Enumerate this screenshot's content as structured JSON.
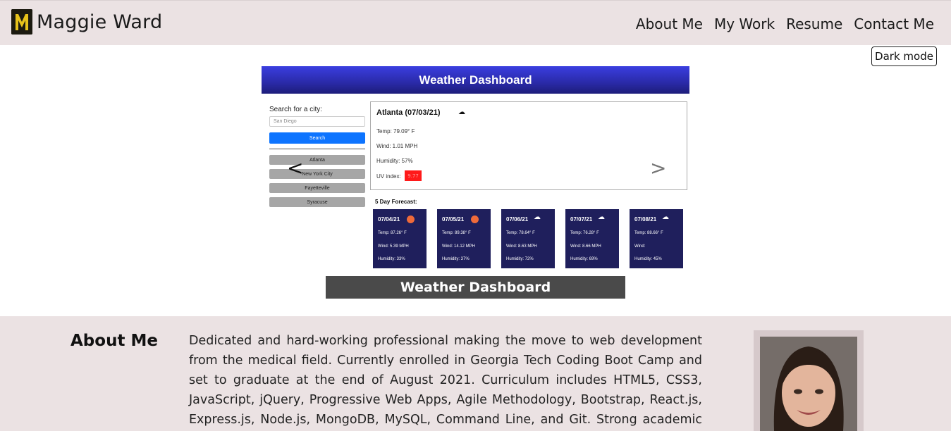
{
  "brand": {
    "name": "Maggie Ward",
    "logo_icon": "mw-monogram-logo",
    "logo_letter": "M"
  },
  "nav": {
    "items": [
      {
        "label": "About Me"
      },
      {
        "label": "My Work"
      },
      {
        "label": "Resume"
      },
      {
        "label": "Contact Me"
      }
    ]
  },
  "dark_mode_label": "Dark mode",
  "carousel": {
    "prev_label": "<",
    "next_label": ">",
    "caption": "Weather Dashboard",
    "slide": {
      "header": "Weather Dashboard",
      "search_label": "Search for a city:",
      "search_value": "San Diego",
      "search_button": "Search",
      "cities": [
        "Atlanta",
        "New York City",
        "Fayetteville",
        "Syracuse"
      ],
      "current": {
        "title": "Atlanta (07/03/21)",
        "temp": "Temp: 79.09° F",
        "wind": "Wind: 1.01 MPH",
        "humidity": "Humidity: 57%",
        "uv_label": "UV index:",
        "uv_value": "9.77"
      },
      "forecast_label": "5 Day Forecast:",
      "forecast": [
        {
          "date": "07/04/21",
          "icon": "sun-icon",
          "temp": "Temp: 87.26° F",
          "wind": "Wind: 5.39 MPH",
          "humidity": "Humidity: 33%"
        },
        {
          "date": "07/05/21",
          "icon": "sun-icon",
          "temp": "Temp: 89.38° F",
          "wind": "Wind: 14.12 MPH",
          "humidity": "Humidity: 37%"
        },
        {
          "date": "07/06/21",
          "icon": "cloud-icon",
          "temp": "Temp: 78.64° F",
          "wind": "Wind: 8.63 MPH",
          "humidity": "Humidity: 72%"
        },
        {
          "date": "07/07/21",
          "icon": "cloud-icon",
          "temp": "Temp: 76.28° F",
          "wind": "Wind: 8.66 MPH",
          "humidity": "Humidity: 69%"
        },
        {
          "date": "07/08/21",
          "icon": "cloud-icon",
          "temp": "Temp: 88.66° F",
          "wind": "Wind:",
          "humidity": "Humidity: 45%"
        }
      ]
    }
  },
  "about": {
    "title": "About Me",
    "text": "Dedicated and hard-working professional making the move to web development from the medical field. Currently enrolled in Georgia Tech Coding Boot Camp and set to graduate at the end of August 2021. Curriculum includes HTML5, CSS3, JavaScript, jQuery, Progressive Web Apps, Agile Methodology, Bootstrap, React.js, Express.js, Node.js, MongoDB, MySQL, Command Line, and Git. Strong academic foundation,"
  },
  "colors": {
    "navbar_bg": "#ebe2e3",
    "dashboard_header": "#2a2aa8",
    "forecast_card": "#1f1f5c",
    "search_button": "#0d74ff",
    "uv_high": "#ff1a1a",
    "caption_bg": "#4a4a4a"
  }
}
